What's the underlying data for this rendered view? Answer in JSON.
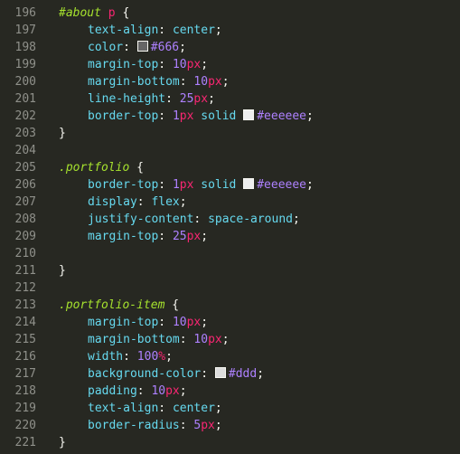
{
  "lines": [
    {
      "n": "196",
      "kind": "open",
      "selector": "#about",
      "tagpart": " p",
      "brace": " {"
    },
    {
      "n": "197",
      "kind": "decl",
      "prop": "text-align",
      "value": "center"
    },
    {
      "n": "198",
      "kind": "decl-color",
      "prop": "color",
      "color": "#666666",
      "value": "#666"
    },
    {
      "n": "199",
      "kind": "decl-unit",
      "prop": "margin-top",
      "num": "10",
      "unit": "px"
    },
    {
      "n": "200",
      "kind": "decl-unit",
      "prop": "margin-bottom",
      "num": "10",
      "unit": "px"
    },
    {
      "n": "201",
      "kind": "decl-unit",
      "prop": "line-height",
      "num": "25",
      "unit": "px"
    },
    {
      "n": "202",
      "kind": "decl-border",
      "prop": "border-top",
      "num": "1",
      "unit": "px",
      "style": "solid",
      "color": "#eeeeee",
      "value": "#eeeeee"
    },
    {
      "n": "203",
      "kind": "close",
      "brace": "}"
    },
    {
      "n": "204",
      "kind": "blank"
    },
    {
      "n": "205",
      "kind": "open",
      "selector": ".portfolio",
      "tagpart": "",
      "brace": " {"
    },
    {
      "n": "206",
      "kind": "decl-border",
      "prop": "border-top",
      "num": "1",
      "unit": "px",
      "style": "solid",
      "color": "#eeeeee",
      "value": "#eeeeee"
    },
    {
      "n": "207",
      "kind": "decl",
      "prop": "display",
      "value": "flex"
    },
    {
      "n": "208",
      "kind": "decl",
      "prop": "justify-content",
      "value": "space-around"
    },
    {
      "n": "209",
      "kind": "decl-unit",
      "prop": "margin-top",
      "num": "25",
      "unit": "px"
    },
    {
      "n": "210",
      "kind": "blank"
    },
    {
      "n": "211",
      "kind": "close",
      "brace": "}"
    },
    {
      "n": "212",
      "kind": "blank"
    },
    {
      "n": "213",
      "kind": "open",
      "selector": ".portfolio-item",
      "tagpart": "",
      "brace": " {"
    },
    {
      "n": "214",
      "kind": "decl-unit",
      "prop": "margin-top",
      "num": "10",
      "unit": "px"
    },
    {
      "n": "215",
      "kind": "decl-unit",
      "prop": "margin-bottom",
      "num": "10",
      "unit": "px"
    },
    {
      "n": "216",
      "kind": "decl-unit",
      "prop": "width",
      "num": "100",
      "unit": "%"
    },
    {
      "n": "217",
      "kind": "decl-color",
      "prop": "background-color",
      "color": "#dddddd",
      "value": "#ddd"
    },
    {
      "n": "218",
      "kind": "decl-unit",
      "prop": "padding",
      "num": "10",
      "unit": "px"
    },
    {
      "n": "219",
      "kind": "decl",
      "prop": "text-align",
      "value": "center"
    },
    {
      "n": "220",
      "kind": "decl-unit",
      "prop": "border-radius",
      "num": "5",
      "unit": "px"
    },
    {
      "n": "221",
      "kind": "close",
      "brace": "}"
    }
  ]
}
